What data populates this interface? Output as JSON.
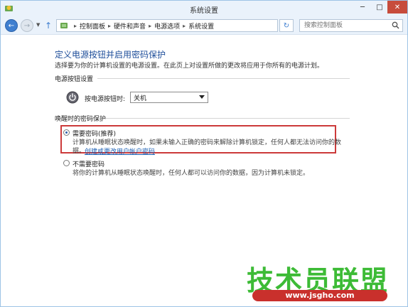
{
  "window": {
    "title": "系统设置",
    "min_glyph": "─",
    "max_glyph": "□",
    "close_glyph": "✕"
  },
  "addressbar": {
    "back_glyph": "←",
    "forward_glyph": "→",
    "history_glyph": "▼",
    "up_glyph": "↑",
    "crumbs": [
      "控制面板",
      "硬件和声音",
      "电源选项",
      "系统设置"
    ],
    "crumb_sep": "▸",
    "dropdown_glyph": "▼",
    "refresh_glyph": "↻",
    "search_placeholder": "搜索控制面板"
  },
  "main": {
    "heading": "定义电源按钮并启用密码保护",
    "description": "选择要为你的计算机设置的电源设置。在此页上对设置所做的更改将应用于你所有的电源计划。",
    "power_group": {
      "label": "电源按钮设置",
      "button_label": "按电源按钮时:",
      "selected_value": "关机"
    },
    "password_group": {
      "label": "唤醒时的密码保护",
      "options": [
        {
          "label": "需要密码(推荐)",
          "desc_line1": "计算机从睡眠状态唤醒时，如果未输入正确的密码来解除计算机锁定，任何人都无法访问你的数",
          "desc_line2": "据。",
          "link": "创建或更改用户帐户密码",
          "checked": true
        },
        {
          "label": "不需要密码",
          "desc_line1": "将你的计算机从睡眠状态唤醒时，任何人都可以访问你的数据，因为计算机未锁定。",
          "checked": false
        }
      ]
    }
  },
  "watermark": {
    "text": "技术员联盟",
    "url": "www.jsgho.com"
  },
  "colors": {
    "accent": "#1e4e9a",
    "highlight_border": "#cc3a3a",
    "watermark_green": "#3dbb36",
    "watermark_red": "#c9302c"
  }
}
